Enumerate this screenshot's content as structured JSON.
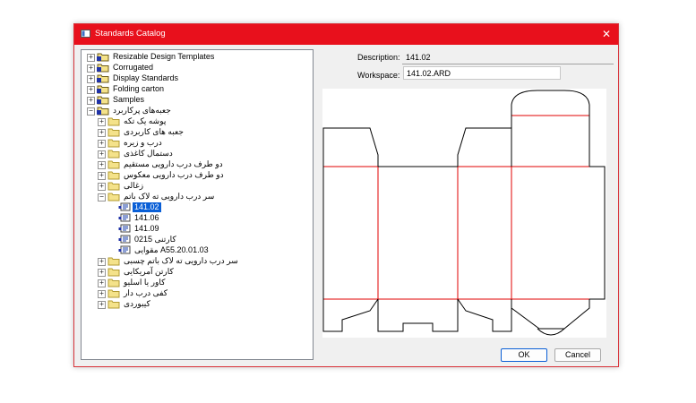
{
  "window": {
    "title": "Standards Catalog",
    "close_glyph": "✕"
  },
  "tree": {
    "items": [
      {
        "label": "Resizable Design Templates",
        "level": 0,
        "expander": "+",
        "icon": "root-folder-icon"
      },
      {
        "label": "Corrugated",
        "level": 0,
        "expander": "+",
        "icon": "root-folder-icon"
      },
      {
        "label": "Display Standards",
        "level": 0,
        "expander": "+",
        "icon": "root-folder-icon"
      },
      {
        "label": "Folding carton",
        "level": 0,
        "expander": "+",
        "icon": "root-folder-icon"
      },
      {
        "label": "Samples",
        "level": 0,
        "expander": "+",
        "icon": "root-folder-icon"
      },
      {
        "label": "جعبه‌های پرکاربرد",
        "level": 0,
        "expander": "−",
        "icon": "root-folder-icon"
      },
      {
        "label": "پوشه یک تکه",
        "level": 1,
        "expander": "+",
        "icon": "folder-icon"
      },
      {
        "label": "جعبه های کاربردی",
        "level": 1,
        "expander": "+",
        "icon": "folder-icon"
      },
      {
        "label": "درب و زیره",
        "level": 1,
        "expander": "+",
        "icon": "folder-icon"
      },
      {
        "label": "دستمال کاغذی",
        "level": 1,
        "expander": "+",
        "icon": "folder-icon"
      },
      {
        "label": "دو طرف درب دارویی مستقیم",
        "level": 1,
        "expander": "+",
        "icon": "folder-icon"
      },
      {
        "label": "دو طرف درب دارویی معکوس",
        "level": 1,
        "expander": "+",
        "icon": "folder-icon"
      },
      {
        "label": "زغالی",
        "level": 1,
        "expander": "+",
        "icon": "folder-icon"
      },
      {
        "label": "سر درب دارویی ته لاک باتم",
        "level": 1,
        "expander": "−",
        "icon": "folder-icon"
      },
      {
        "label": "141.02",
        "level": 2,
        "expander": "",
        "icon": "design-file-icon",
        "selected": true
      },
      {
        "label": "141.06",
        "level": 2,
        "expander": "",
        "icon": "design-file-icon"
      },
      {
        "label": "141.09",
        "level": 2,
        "expander": "",
        "icon": "design-file-icon"
      },
      {
        "label": "کارتنی   0215",
        "level": 2,
        "expander": "",
        "icon": "design-file-icon"
      },
      {
        "label": "مقوایی   A55.20.01.03",
        "level": 2,
        "expander": "",
        "icon": "design-file-icon"
      },
      {
        "label": "سر درب دارویی ته لاک باتم چسبی",
        "level": 1,
        "expander": "+",
        "icon": "folder-icon"
      },
      {
        "label": "کارتن آمریکایی",
        "level": 1,
        "expander": "+",
        "icon": "folder-icon"
      },
      {
        "label": "کاور یا اسلیو",
        "level": 1,
        "expander": "+",
        "icon": "folder-icon"
      },
      {
        "label": "کفی درب دار",
        "level": 1,
        "expander": "+",
        "icon": "folder-icon"
      },
      {
        "label": "کیبوردی",
        "level": 1,
        "expander": "+",
        "icon": "folder-icon"
      }
    ]
  },
  "details": {
    "description_label": "Description:",
    "description_value": "141.02",
    "workspace_label": "Workspace:",
    "workspace_value": "141.02.ARD"
  },
  "buttons": {
    "ok": "OK",
    "cancel": "Cancel"
  },
  "colors": {
    "titlebar": "#e8101c",
    "cut_line": "#000000",
    "crease_line": "#e00000",
    "selection": "#0a5fd6"
  }
}
